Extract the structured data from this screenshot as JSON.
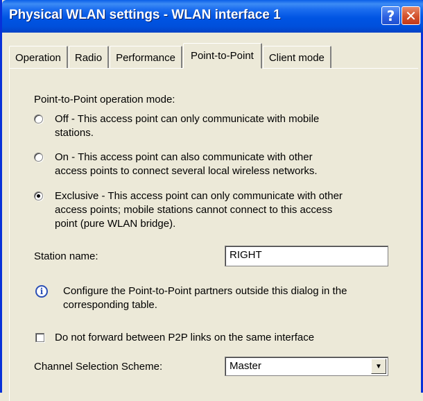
{
  "window": {
    "title": "Physical WLAN settings - WLAN interface 1",
    "help_label": "?",
    "close_label": "✕"
  },
  "tabs": [
    {
      "label": "Operation",
      "active": false
    },
    {
      "label": "Radio",
      "active": false
    },
    {
      "label": "Performance",
      "active": false
    },
    {
      "label": "Point-to-Point",
      "active": true
    },
    {
      "label": "Client mode",
      "active": false
    }
  ],
  "p2p": {
    "mode_heading": "Point-to-Point operation mode:",
    "options": [
      {
        "label_line1": "Off - This access point can only communicate with mobile",
        "label_line2": "stations.",
        "checked": false
      },
      {
        "label_line1": "On - This access point can also communicate with other",
        "label_line2": "access points to connect several local wireless networks.",
        "checked": false
      },
      {
        "label_line1": "Exclusive - This access point can only communicate with other",
        "label_line2": "access points; mobile stations cannot connect to this access",
        "label_line3": "point (pure WLAN bridge).",
        "checked": true
      }
    ],
    "station_name_label": "Station name:",
    "station_name_value": "RIGHT",
    "info_line1": "Configure the Point-to-Point partners outside this dialog in the",
    "info_line2": "corresponding table.",
    "no_forward_label": "Do not forward between P2P links on the same interface",
    "no_forward_checked": false,
    "channel_label": "Channel Selection Scheme:",
    "channel_value": "Master"
  },
  "icons": {
    "info": "info-icon",
    "dropdown": "chevron-down-icon"
  },
  "colors": {
    "titlebar": "#0054E3",
    "dialog_bg": "#ECE9D8",
    "close_button": "#D3522D"
  }
}
